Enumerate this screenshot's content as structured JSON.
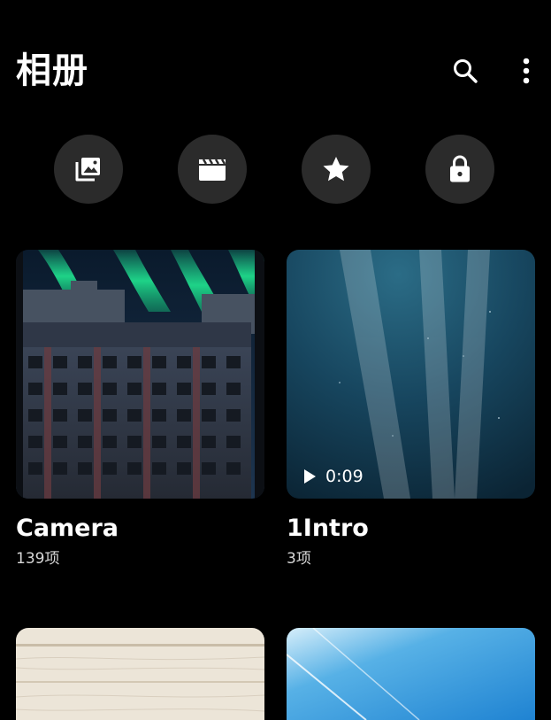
{
  "header": {
    "title": "相册",
    "actions": [
      {
        "icon": "search-icon"
      },
      {
        "icon": "more-vert-icon"
      }
    ]
  },
  "quick_actions": [
    {
      "icon": "photo-library-icon"
    },
    {
      "icon": "video-clapper-icon"
    },
    {
      "icon": "star-icon"
    },
    {
      "icon": "lock-icon"
    }
  ],
  "albums": [
    {
      "name": "Camera",
      "count": "139项"
    },
    {
      "name": "1Intro",
      "count": "3项",
      "video_duration": "0:09"
    },
    {
      "name": "",
      "count": ""
    },
    {
      "name": "",
      "count": ""
    }
  ],
  "colors": {
    "background": "#000000",
    "button_bg": "#2b2b2b",
    "text": "#ffffff",
    "subtext": "#d8d8d8"
  }
}
